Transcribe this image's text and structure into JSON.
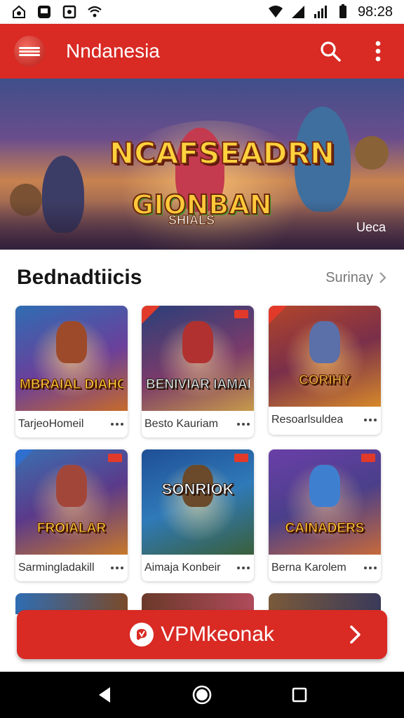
{
  "status_bar": {
    "time": "98:28"
  },
  "app_bar": {
    "title": "Nndanesia"
  },
  "banner": {
    "title": "NCAFSEADRN",
    "subtitle": "GIONBAN",
    "tagline": "SHIALS",
    "corner_text": "Ueca"
  },
  "section": {
    "title": "Bednadtiicis",
    "see_all": "Surinay"
  },
  "cards": [
    {
      "thumb_text": "MBRAIAL DIAHOANO",
      "name": "TarjeoHomeil"
    },
    {
      "thumb_text": "BENIVIAR IAMAIANI",
      "name": "Besto Kauriam"
    },
    {
      "thumb_text": "CORIHY",
      "name": "Resoarlsuldea"
    },
    {
      "thumb_text": "FROIALAR",
      "name": "Sarmingladakill"
    },
    {
      "thumb_text": "SONRIOK",
      "name": "Aimaja Konbeir"
    },
    {
      "thumb_text": "CAINADERS",
      "name": "Berna Karolem"
    }
  ],
  "cta": {
    "label": "VPMkeonak"
  },
  "colors": {
    "accent": "#d92a24",
    "nav": "#000000"
  }
}
